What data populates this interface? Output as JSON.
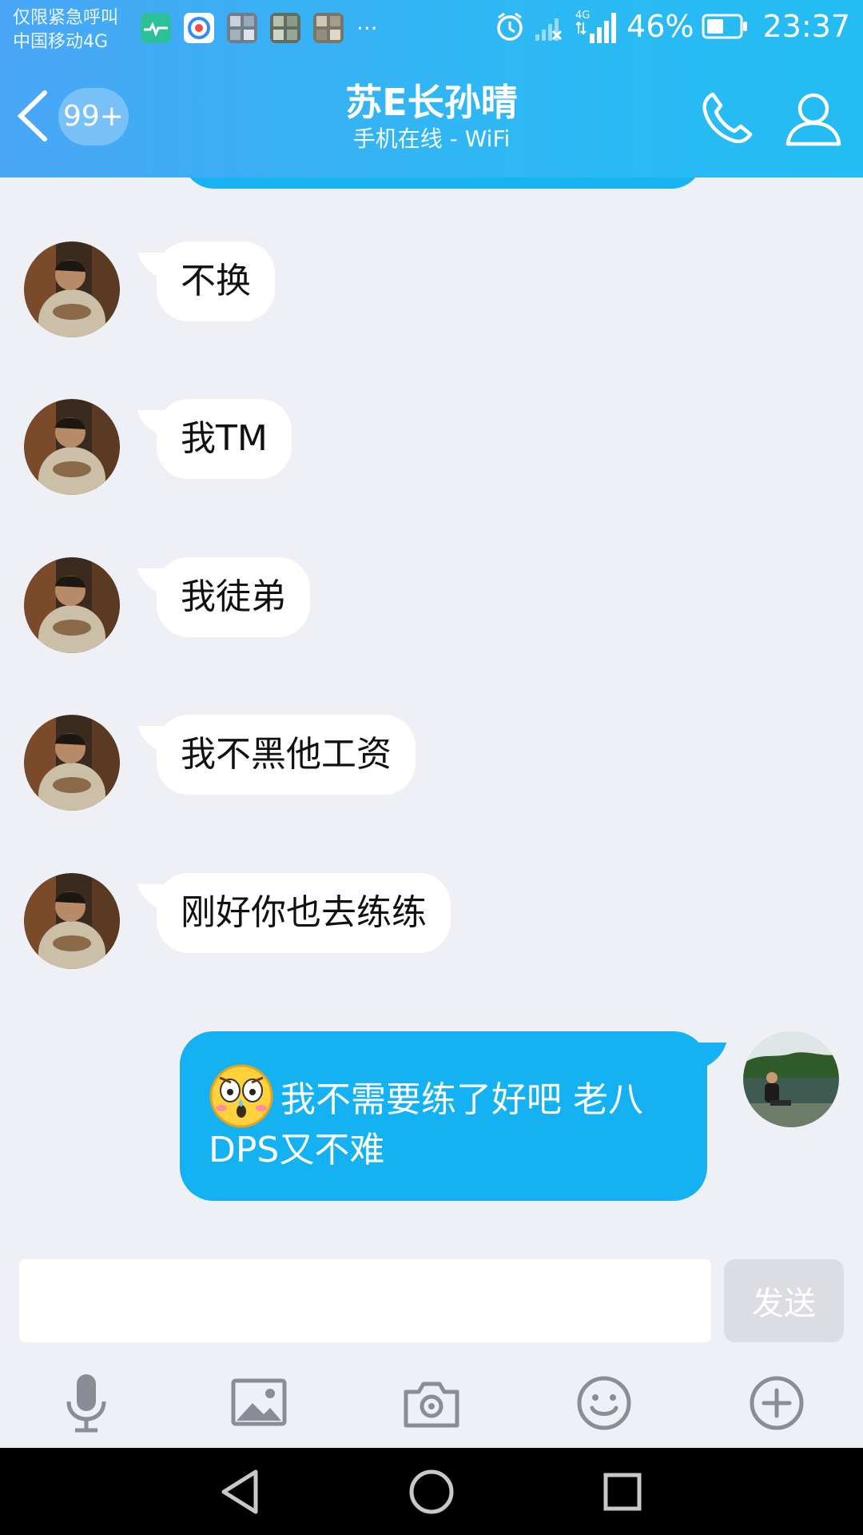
{
  "status_bar": {
    "line1": "仅限紧急呼叫",
    "line2": "中国移动4G",
    "more": "···",
    "network": "4G",
    "battery": "46%",
    "time": "23:37"
  },
  "header": {
    "back_badge": "99+",
    "title": "苏E长孙晴",
    "subtitle": "手机在线 - WiFi"
  },
  "messages": [
    {
      "text": "不换"
    },
    {
      "text": "我TM"
    },
    {
      "text": "我徒弟"
    },
    {
      "text": "我不黑他工资"
    },
    {
      "text": "刚好你也去练练"
    }
  ],
  "my_message": {
    "text": "我不需要练了好吧  老八DPS又不难"
  },
  "composer": {
    "placeholder": "",
    "send_label": "发送"
  },
  "colors": {
    "accent": "#14b2f2",
    "background": "#eff0f5",
    "icon_gray": "#8b8d96"
  }
}
